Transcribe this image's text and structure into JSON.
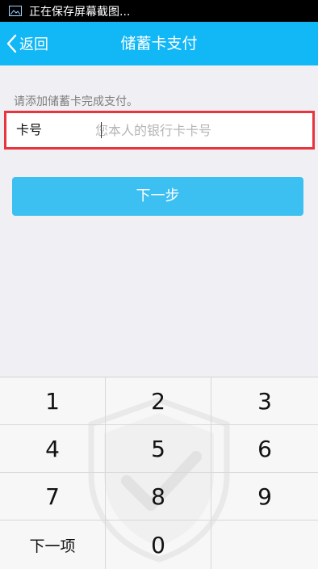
{
  "status_bar": {
    "icon": "image-icon",
    "text": "正在保存屏幕截图..."
  },
  "nav": {
    "back_label": "返回",
    "title": "储蓄卡支付",
    "color": "#12b7f5"
  },
  "form": {
    "hint": "请添加储蓄卡完成支付。",
    "card_label": "卡号",
    "card_value": "",
    "card_placeholder": "您本人的银行卡卡号",
    "highlight_color": "#e8343d"
  },
  "next_button": {
    "label": "下一步",
    "color": "#3cc0f1"
  },
  "keypad": {
    "keys": [
      "1",
      "2",
      "3",
      "4",
      "5",
      "6",
      "7",
      "8",
      "9",
      "下一项",
      "0"
    ],
    "watermark_icon": "shield-check-icon"
  }
}
